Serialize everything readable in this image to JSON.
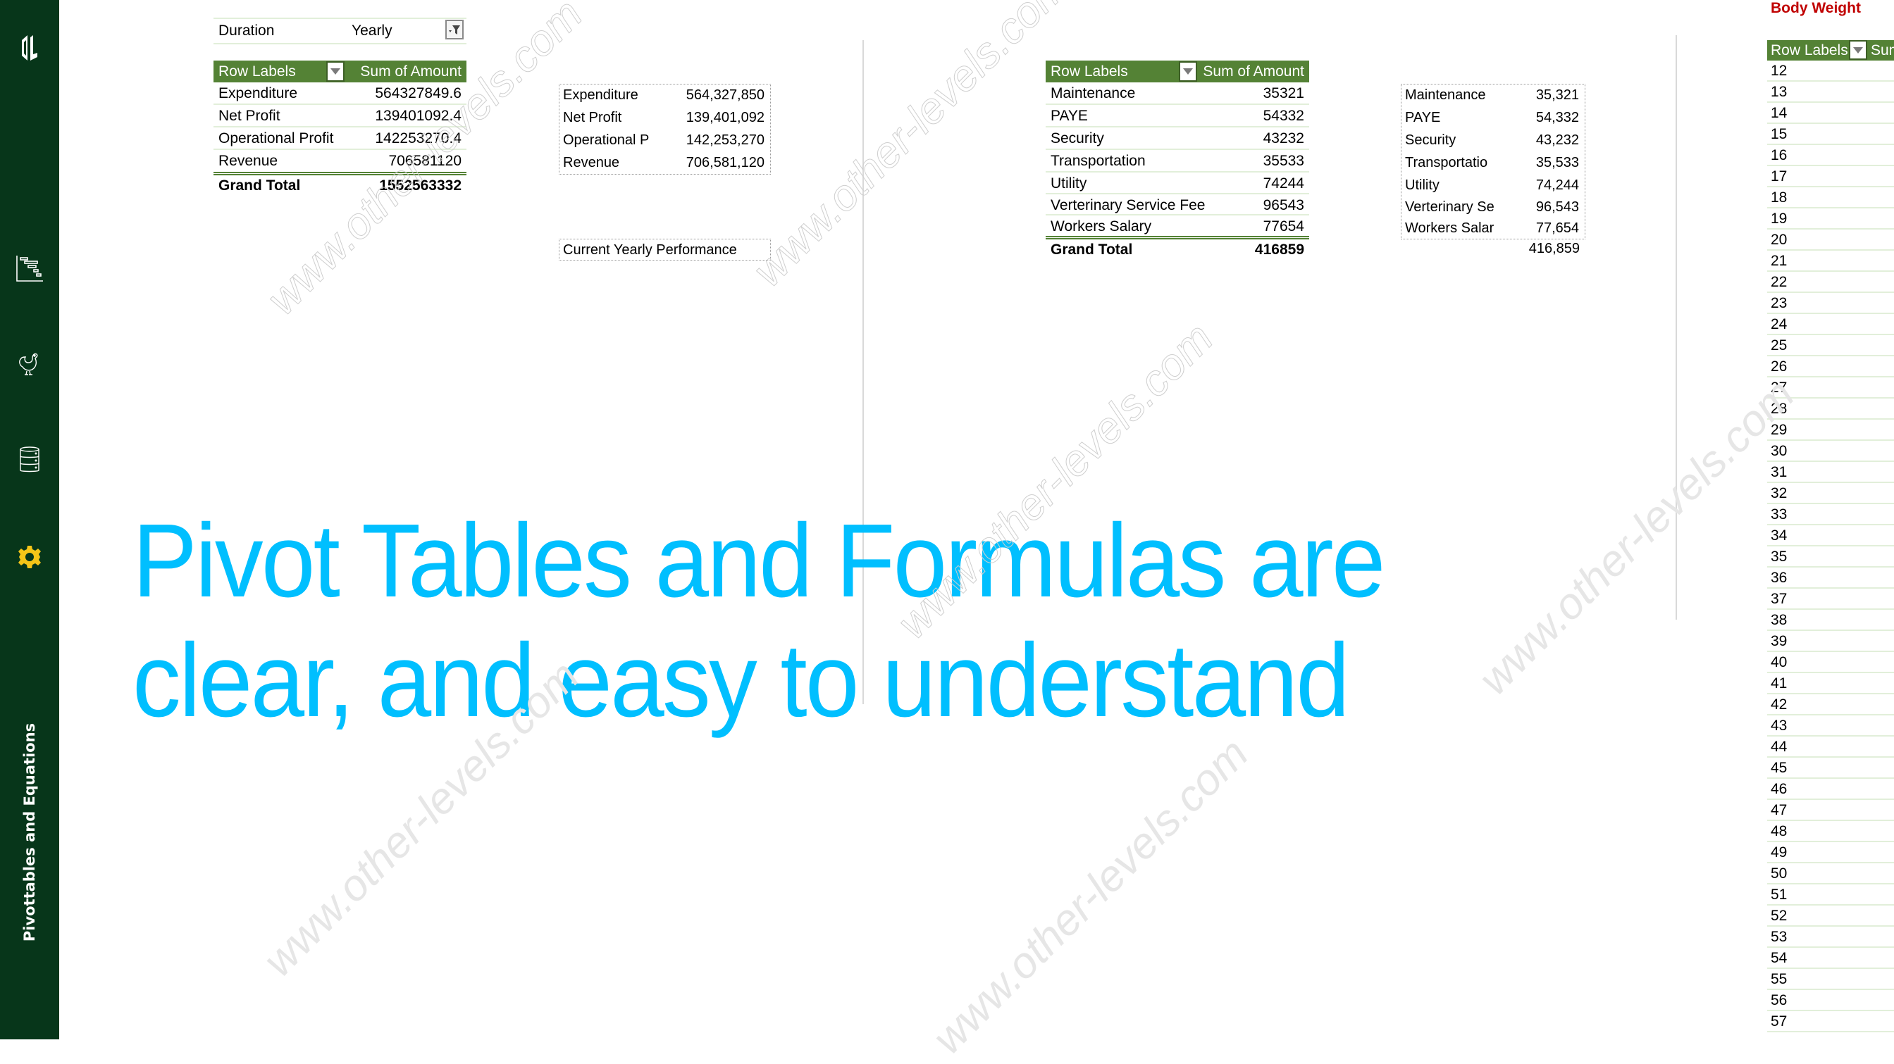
{
  "sidebar": {
    "title": "Pivottables and Equations",
    "icons": [
      "logo-icon",
      "gantt-chart-icon",
      "chicken-icon",
      "database-icon",
      "gear-icon"
    ],
    "accent_color": "#f5c518",
    "background_color": "#07361a"
  },
  "slicer": {
    "label": "Duration",
    "value": "Yearly"
  },
  "pivot_summary": {
    "header": {
      "row_labels": "Row Labels",
      "sum_label": "Sum of Amount"
    },
    "rows": [
      {
        "label": "Expenditure",
        "value": "564327849.6"
      },
      {
        "label": "Net Profit",
        "value": "139401092.4"
      },
      {
        "label": "Operational Profit",
        "value": "142253270.4"
      },
      {
        "label": "Revenue",
        "value": "706581120"
      }
    ],
    "grand_total": {
      "label": "Grand Total",
      "value": "1552563332"
    }
  },
  "formula_summary": {
    "rows": [
      {
        "label": "Expenditure",
        "value": "564,327,850"
      },
      {
        "label": "Net Profit",
        "value": "139,401,092"
      },
      {
        "label": "Operational P",
        "value": "142,253,270"
      },
      {
        "label": "Revenue",
        "value": "706,581,120"
      }
    ],
    "caption": "Current Yearly Performance"
  },
  "pivot_expenses": {
    "header": {
      "row_labels": "Row Labels",
      "sum_label": "Sum of Amount"
    },
    "rows": [
      {
        "label": "Maintenance",
        "value": "35321"
      },
      {
        "label": "PAYE",
        "value": "54332"
      },
      {
        "label": "Security",
        "value": "43232"
      },
      {
        "label": "Transportation",
        "value": "35533"
      },
      {
        "label": "Utility",
        "value": "74244"
      },
      {
        "label": "Verterinary Service Fee",
        "value": "96543"
      },
      {
        "label": "Workers Salary",
        "value": "77654"
      }
    ],
    "grand_total": {
      "label": "Grand Total",
      "value": "416859"
    }
  },
  "formula_expenses": {
    "rows": [
      {
        "label": "Maintenance",
        "value": "35,321"
      },
      {
        "label": "PAYE",
        "value": "54,332"
      },
      {
        "label": "Security",
        "value": "43,232"
      },
      {
        "label": "Transportatio",
        "value": "35,533"
      },
      {
        "label": "Utility",
        "value": "74,244"
      },
      {
        "label": "Verterinary Se",
        "value": "96,543"
      },
      {
        "label": "Workers Salar",
        "value": "77,654"
      }
    ],
    "total": "416,859"
  },
  "body_weight": {
    "title": "Body Weight",
    "header": {
      "row_labels": "Row Labels",
      "sum_label": "Sum"
    },
    "rows": [
      "12",
      "13",
      "14",
      "15",
      "16",
      "17",
      "18",
      "19",
      "20",
      "21",
      "22",
      "23",
      "24",
      "25",
      "26",
      "27",
      "28",
      "29",
      "30",
      "31",
      "32",
      "33",
      "34",
      "35",
      "36",
      "37",
      "38",
      "39",
      "40",
      "41",
      "42",
      "43",
      "44",
      "45",
      "46",
      "47",
      "48",
      "49",
      "50",
      "51",
      "52",
      "53",
      "54",
      "55",
      "56",
      "57"
    ]
  },
  "headline": {
    "line1": "Pivot Tables and Formulas are",
    "line2": "clear, and easy to understand"
  },
  "watermark": "www.other-levels.com"
}
